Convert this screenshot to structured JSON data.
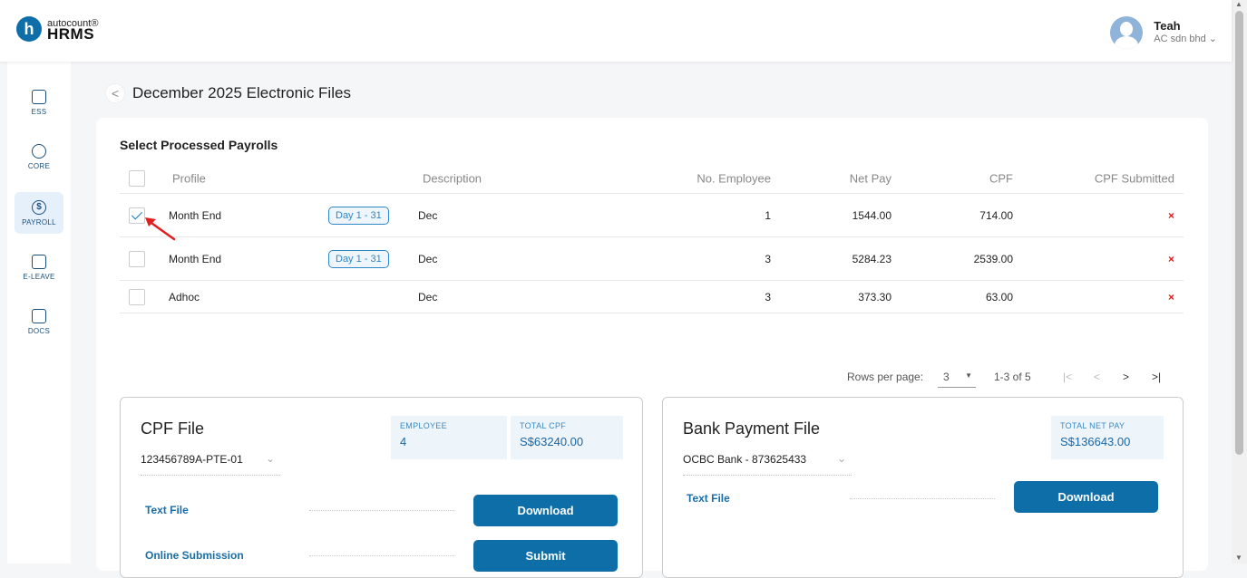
{
  "brand": {
    "logo_letter": "h",
    "logo_top": "autocount®",
    "logo_bottom": "HRMS"
  },
  "user": {
    "name": "Teah",
    "company": "AC sdn bhd ⌄"
  },
  "sidebar": {
    "items": [
      {
        "label": "ESS",
        "icon": "ess-icon"
      },
      {
        "label": "CORE",
        "icon": "core-icon"
      },
      {
        "label": "PAYROLL",
        "icon": "payroll-dollar-icon",
        "active": true
      },
      {
        "label": "E-LEAVE",
        "icon": "calendar-icon"
      },
      {
        "label": "DOCS",
        "icon": "document-chart-icon"
      }
    ]
  },
  "page": {
    "title": "December 2025 Electronic Files",
    "back": "<"
  },
  "payrolls": {
    "section_title": "Select Processed Payrolls",
    "headers": [
      "Profile",
      "Description",
      "No. Employee",
      "Net Pay",
      "CPF",
      "CPF Submitted"
    ],
    "rows": [
      {
        "profile": "Month End",
        "period": "Day 1 - 31",
        "description": "Dec",
        "employees": "1",
        "net_pay": "1544.00",
        "cpf": "714.00",
        "submitted": "×",
        "checked": true
      },
      {
        "profile": "Month End",
        "period": "Day 1 - 31",
        "description": "Dec",
        "employees": "3",
        "net_pay": "5284.23",
        "cpf": "2539.00",
        "submitted": "×",
        "checked": false
      },
      {
        "profile": "Adhoc",
        "period": "",
        "description": "Dec",
        "employees": "3",
        "net_pay": "373.30",
        "cpf": "63.00",
        "submitted": "×",
        "checked": false
      }
    ],
    "pager": {
      "rows_label": "Rows per page:",
      "rows_value": "3",
      "range": "1-3 of 5",
      "first": "|<",
      "prev": "<",
      "next": ">",
      "last": ">|"
    }
  },
  "cpf_file": {
    "title": "CPF File",
    "select_value": "123456789A-PTE-01",
    "employee_label": "EMPLOYEE",
    "employee_value": "4",
    "total_label": "TOTAL CPF",
    "total_value": "S$63240.00",
    "text_file_label": "Text File",
    "download_label": "Download",
    "online_label": "Online Submission",
    "submit_label": "Submit"
  },
  "bank_file": {
    "title": "Bank Payment File",
    "select_value": "OCBC Bank - 873625433",
    "total_label": "TOTAL NET PAY",
    "total_value": "S$136643.00",
    "text_file_label": "Text File",
    "download_label": "Download"
  }
}
